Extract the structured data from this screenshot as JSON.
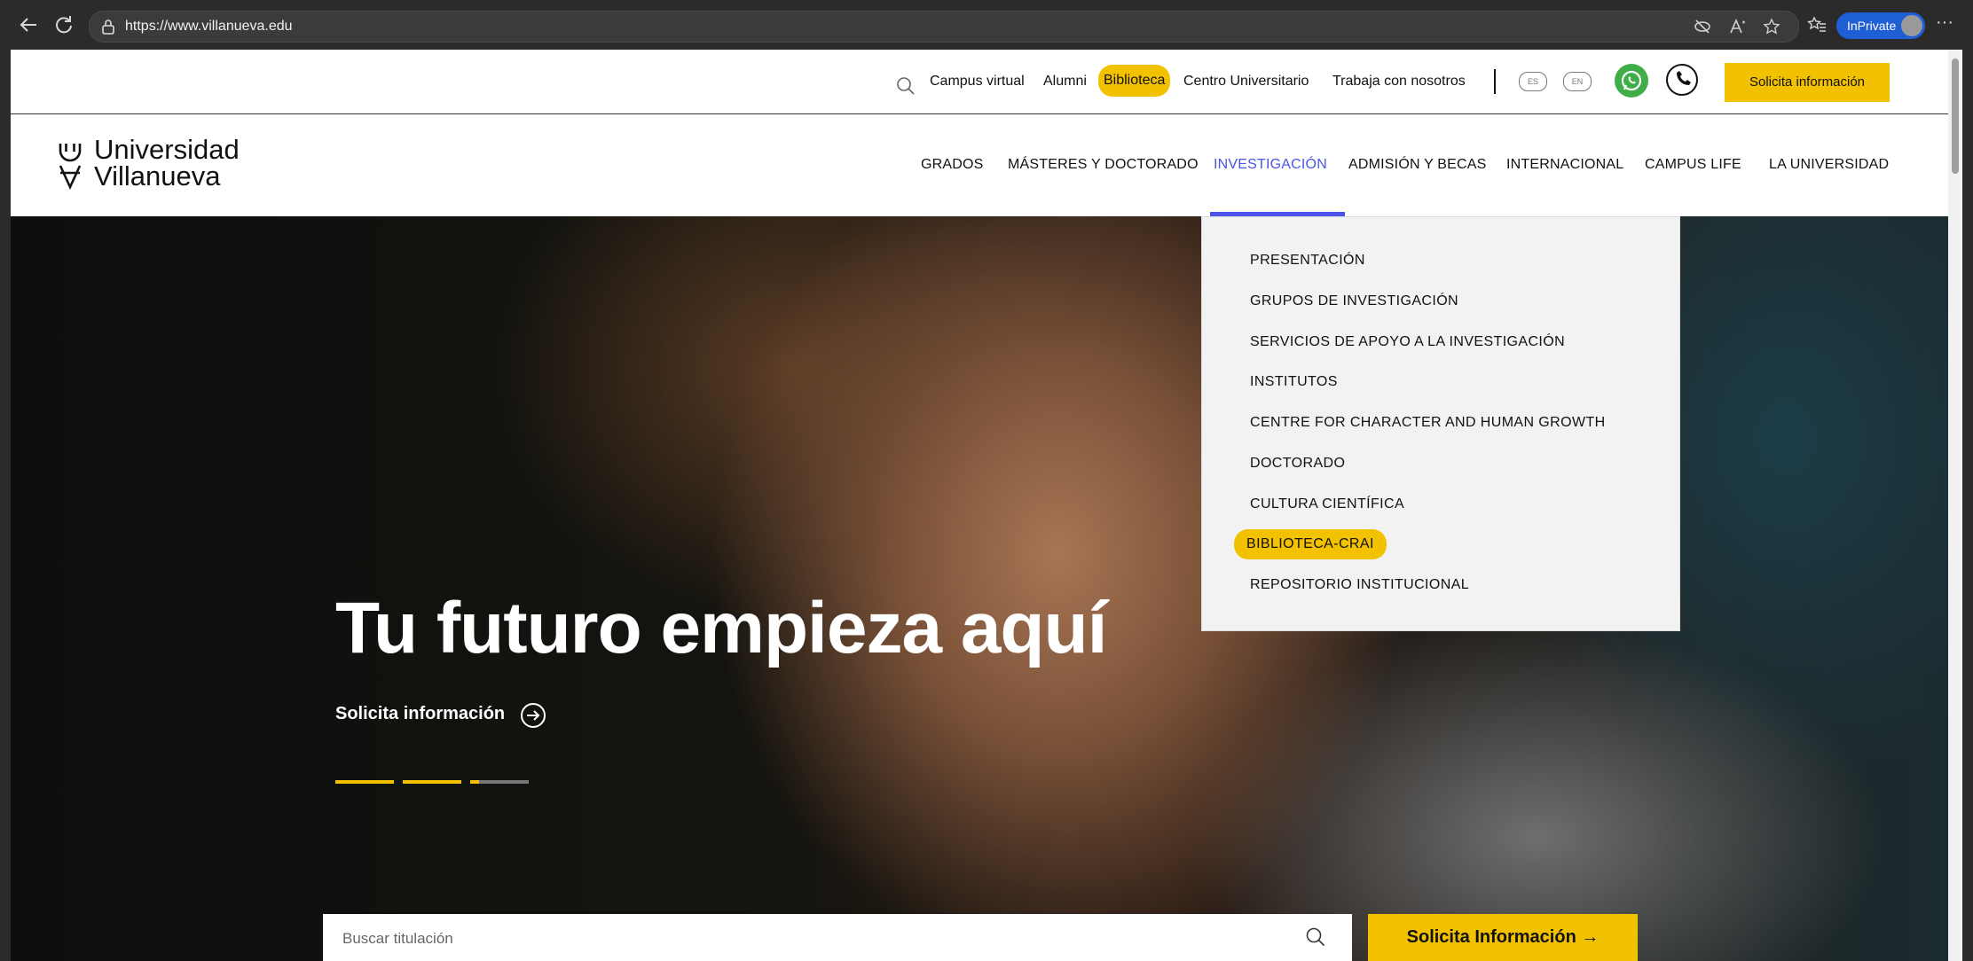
{
  "browser": {
    "url": "https://www.villanueva.edu",
    "inprivate_label": "InPrivate"
  },
  "utilbar": {
    "links": [
      "Campus virtual",
      "Alumni",
      "Biblioteca",
      "Centro Universitario",
      "Trabaja con nosotros"
    ],
    "lang_es": "ES",
    "lang_en": "EN",
    "cta": "Solicita información"
  },
  "logo": {
    "line1": "Universidad",
    "line2": "Villanueva"
  },
  "menu": {
    "items": [
      "GRADOS",
      "MÁSTERES Y DOCTORADO",
      "INVESTIGACIÓN",
      "ADMISIÓN Y BECAS",
      "INTERNACIONAL",
      "CAMPUS LIFE",
      "LA UNIVERSIDAD"
    ],
    "active": "INVESTIGACIÓN"
  },
  "dropdown": {
    "items": [
      "PRESENTACIÓN",
      "GRUPOS DE INVESTIGACIÓN",
      "SERVICIOS DE APOYO A LA INVESTIGACIÓN",
      "INSTITUTOS",
      "CENTRE FOR CHARACTER AND HUMAN GROWTH",
      "DOCTORADO",
      "CULTURA CIENTÍFICA",
      "BIBLIOTECA-CRAI",
      "REPOSITORIO INSTITUCIONAL"
    ],
    "highlighted": "BIBLIOTECA-CRAI"
  },
  "hero": {
    "title": "Tu futuro empieza aquí",
    "cta": "Solicita información",
    "slides_total": 3,
    "slides_progress": [
      1,
      1,
      0.15
    ]
  },
  "search": {
    "placeholder": "Buscar titulación"
  },
  "bottom_cta": "Solicita Información →",
  "colors": {
    "accent_yellow": "#f2c100",
    "active_blue": "#4b53e8",
    "whatsapp_green": "#3fae49"
  },
  "icons": [
    "back-icon",
    "refresh-icon",
    "lock-icon",
    "tracking-icon",
    "read-aloud-icon",
    "favorite-icon",
    "favorites-icon",
    "more-icon",
    "search-icon",
    "whatsapp-icon",
    "phone-icon",
    "arrow-circle-icon",
    "arrow-right-icon"
  ]
}
